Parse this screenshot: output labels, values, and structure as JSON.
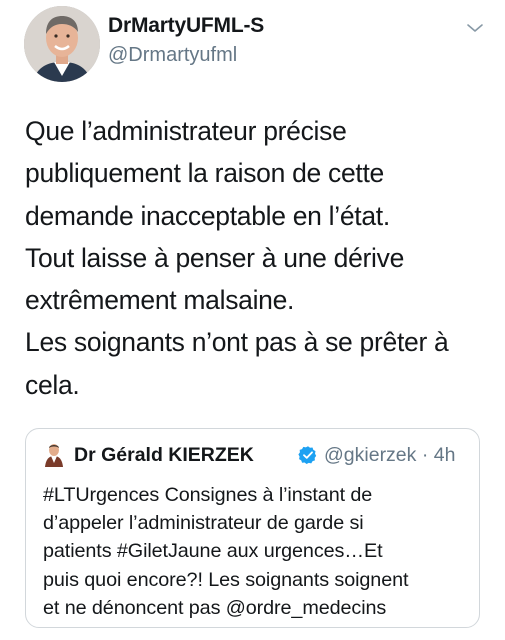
{
  "tweet": {
    "author": {
      "display_name": "DrMartyUFML-S",
      "handle": "@Drmartyufml",
      "avatar_icon": "profile-photo"
    },
    "menu_icon": "chevron-down-icon",
    "text_lines": [
      "Que l’administrateur précise",
      "publiquement la raison de cette",
      "demande inacceptable en l’état.",
      "Tout laisse à penser à une dérive",
      "extrêmement malsaine.",
      "Les soignants n’ont pas à se prêter à",
      "cela."
    ],
    "quoted_tweet": {
      "author_name": "Dr Gérald KIERZEK",
      "verified_icon": "verified-badge-icon",
      "handle": "@gkierzek",
      "separator": "·",
      "time": "4h",
      "text_lines": [
        "#LTUrgences Consignes à l’instant de",
        "d’appeler l’administrateur de garde si",
        "patients #GiletJaune aux urgences…Et",
        "puis quoi encore?! Les soignants soignent",
        "et ne dénoncent pas @ordre_medecins"
      ]
    }
  },
  "colors": {
    "text": "#14171a",
    "secondary": "#657786",
    "verified": "#1da1f2",
    "border": "#d2d7db"
  }
}
